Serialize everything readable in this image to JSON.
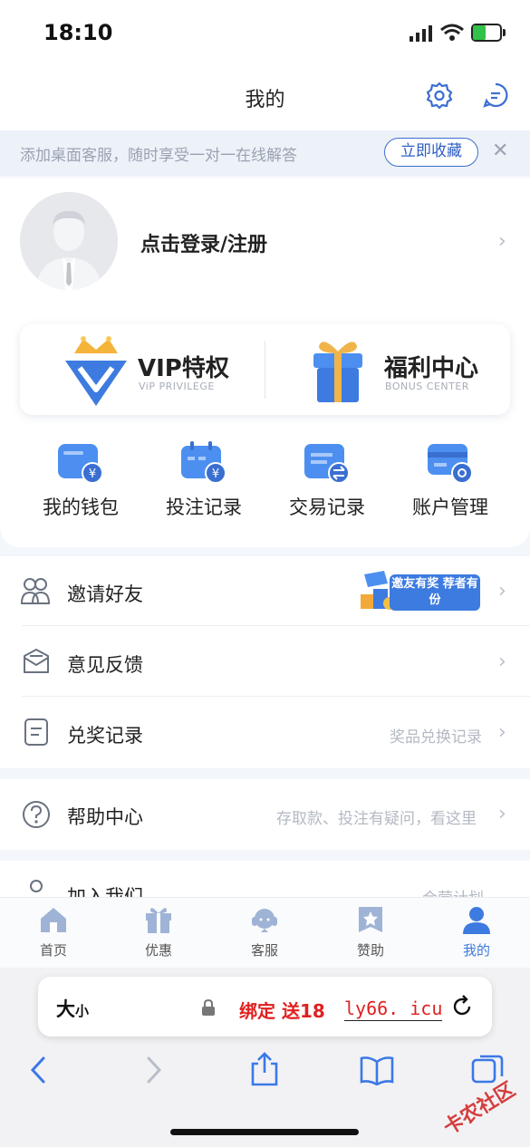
{
  "status_bar": {
    "time": "18:10"
  },
  "header": {
    "title": "我的"
  },
  "banner": {
    "text": "添加桌面客服，随时享受一对一在线解答",
    "collect_button": "立即收藏"
  },
  "profile": {
    "login_text": "点击登录/注册"
  },
  "vip": {
    "vip_title": "VIP特权",
    "vip_sub": "ViP PRIVILEGE",
    "bonus_title": "福利中心",
    "bonus_sub": "BONUS CENTER"
  },
  "quick_actions": [
    {
      "label": "我的钱包",
      "icon": "wallet-icon"
    },
    {
      "label": "投注记录",
      "icon": "calendar-icon"
    },
    {
      "label": "交易记录",
      "icon": "exchange-icon"
    },
    {
      "label": "账户管理",
      "icon": "card-icon"
    }
  ],
  "menu": [
    {
      "label": "邀请好友",
      "note": "",
      "badge": "邀友有奖 荐者有份",
      "icon": "users-icon"
    },
    {
      "label": "意见反馈",
      "note": "",
      "icon": "feedback-icon"
    },
    {
      "label": "兑奖记录",
      "note": "奖品兑换记录",
      "icon": "document-icon"
    },
    {
      "label": "帮助中心",
      "note": "存取款、投注有疑问，看这里",
      "icon": "help-icon"
    },
    {
      "label": "加入我们",
      "note": "合营计划",
      "icon": "user-icon"
    }
  ],
  "tabs": [
    {
      "label": "首页",
      "icon": "home-icon"
    },
    {
      "label": "优惠",
      "icon": "gift-icon"
    },
    {
      "label": "客服",
      "icon": "headset-icon"
    },
    {
      "label": "赞助",
      "icon": "star-badge-icon"
    },
    {
      "label": "我的",
      "icon": "person-icon",
      "active": true
    }
  ],
  "browser": {
    "text_size_big": "大",
    "text_size_small": "小",
    "url_red": "绑定 送18",
    "url_domain": "ly66. icu"
  },
  "watermark": "卡农社区",
  "colors": {
    "accent": "#3b6fd1",
    "active_tab": "#3d7be0",
    "red": "#e02020"
  }
}
